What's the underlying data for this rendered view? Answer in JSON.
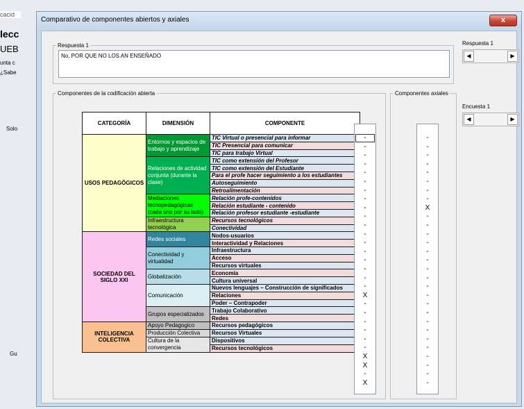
{
  "background_app": {
    "fragments": [
      "cacid",
      "lecc",
      "UEB",
      "unta c",
      "¿Sabe",
      "Solo",
      "Gu"
    ]
  },
  "dialog": {
    "title": "Comparativo de componentes abiertos y axiales",
    "close_label": "x"
  },
  "respuesta": {
    "group_label": "Respuesta 1",
    "text": "No, POR QUE NO LOS AN ENSEÑADO",
    "scroll_label": "Respuesta 1"
  },
  "encuesta": {
    "scroll_label": "Encuesta 1"
  },
  "scroll_left": "◀",
  "scroll_right": "▶",
  "abiertos": {
    "group_label": "Componentes de la codificación abierta",
    "headers": [
      "CATEGORÍA",
      "DIMENSIÓN",
      "COMPONENTE"
    ]
  },
  "axiales": {
    "group_label": "Componentes axiales"
  },
  "categories": [
    {
      "label": "USOS PEDAGÓGICOS",
      "color": "#ffffcc"
    },
    {
      "label": "SOCIEDAD DEL SIGLO XXI",
      "color": "#fcc6f2"
    },
    {
      "label": "INTELIGENCIA COLECTIVA",
      "color": "#fac090"
    }
  ],
  "dimensions": [
    {
      "label": "Entornos y espacios de trabajo y aprendizaje",
      "color": "#009933"
    },
    {
      "label": "Relaciones de actividad conjunta (durante la clase)",
      "color": "#00b050"
    },
    {
      "label": "Mediaciones tecnopedagógicas (cada uno por su lado)",
      "color": "#00ff00"
    },
    {
      "label": "Infraestructura tecnológica",
      "color": "#92d050"
    },
    {
      "label": "Redes sociales",
      "color": "#31859c"
    },
    {
      "label": "Conectividad y virtualidad",
      "color": "#92cddc"
    },
    {
      "label": "Globalización",
      "color": "#b7dee8"
    },
    {
      "label": "Comunicación",
      "color": "#daeef3"
    },
    {
      "label": "Grupos especializados",
      "color": "#bfbfbf"
    },
    {
      "label": "Apoyo Pedagogico",
      "color": "#c0c0c0"
    },
    {
      "label": "Producción Colectiva",
      "color": "#d9d9d9"
    },
    {
      "label": "Cultura de la convergencia",
      "color": "#e6e6e6"
    }
  ],
  "components": [
    {
      "label": "TIC Virtual o presencial para informar",
      "color": "#dce6f1",
      "open": "-",
      "axial": "-"
    },
    {
      "label": "TIC Presencial para comunicar",
      "color": "#f2dcdb",
      "open": "-",
      "axial": "-"
    },
    {
      "label": "TIC para trabajo Virtual",
      "color": "#dce6f1",
      "open": "-",
      "axial": "-"
    },
    {
      "label": "TIC como extensión del Profesor",
      "color": "#dce6f1",
      "open": "-",
      "axial": "-"
    },
    {
      "label": "TIC como extensión del Estudiante",
      "color": "#dce6f1",
      "open": "-",
      "axial": "-"
    },
    {
      "label": "Para el profe hacer seguimiento a los estudiantes",
      "color": "#f2dcdb",
      "open": "-",
      "axial": "-"
    },
    {
      "label": "Autoseguimiento",
      "color": "#dce6f1",
      "open": "-",
      "axial": "-"
    },
    {
      "label": "Retroalimentación",
      "color": "#f2dcdb",
      "open": "-",
      "axial": "-"
    },
    {
      "label": "Relación profe-contenidos",
      "color": "#dce6f1",
      "open": "-",
      "axial": "X"
    },
    {
      "label": "Relación estudiante - contenido",
      "color": "#f2dcdb",
      "open": "-",
      "axial": "-"
    },
    {
      "label": "Relación profesor estudiante -estudiante",
      "color": "#dce6f1",
      "open": "-",
      "axial": "-"
    },
    {
      "label": "Recursos tecnológicos",
      "color": "#f2dcdb",
      "open": "-",
      "axial": "-"
    },
    {
      "label": "Conectividad",
      "color": "#dce6f1",
      "open": "-",
      "axial": "-"
    },
    {
      "label": "Nodos-usuarios",
      "color": "#dce6f1",
      "open": "-",
      "axial": "-"
    },
    {
      "label": "Interactividad y Relaciones",
      "color": "#f2dcdb",
      "open": "-",
      "axial": "-"
    },
    {
      "label": "Infraestructura",
      "color": "#dce6f1",
      "open": "-",
      "axial": "-"
    },
    {
      "label": "Acceso",
      "color": "#f2dcdb",
      "open": "-",
      "axial": "-"
    },
    {
      "label": "Recursos virtuales",
      "color": "#dce6f1",
      "open": "-",
      "axial": "-"
    },
    {
      "label": "Economía",
      "color": "#f2dcdb",
      "open": "X",
      "axial": "-"
    },
    {
      "label": "Cultura universal",
      "color": "#dce6f1",
      "open": "-",
      "axial": "-"
    },
    {
      "label": "Nuevos lenguajes – Construcción de significados",
      "color": "#dce6f1",
      "open": "-",
      "axial": "-"
    },
    {
      "label": "Relaciones",
      "color": "#f2dcdb",
      "open": "-",
      "axial": "-"
    },
    {
      "label": "Poder – Contrapoder",
      "color": "#dce6f1",
      "open": "-",
      "axial": "-"
    },
    {
      "label": "Trabajo  Colaborativo",
      "color": "#dce6f1",
      "open": "-",
      "axial": "-"
    },
    {
      "label": "Redes",
      "color": "#f2dcdb",
      "open": "-",
      "axial": "-"
    },
    {
      "label": "Recursos pedagógicos",
      "color": "#dce6f1",
      "open": "X",
      "axial": "-"
    },
    {
      "label": "Recursos Virtuales",
      "color": "#dce6f1",
      "open": "X",
      "axial": "-"
    },
    {
      "label": "Dispositivos",
      "color": "#dce6f1",
      "open": "-",
      "axial": "-"
    },
    {
      "label": "Recursos tecnológicos",
      "color": "#f2dcdb",
      "open": "X",
      "axial": "-"
    }
  ]
}
